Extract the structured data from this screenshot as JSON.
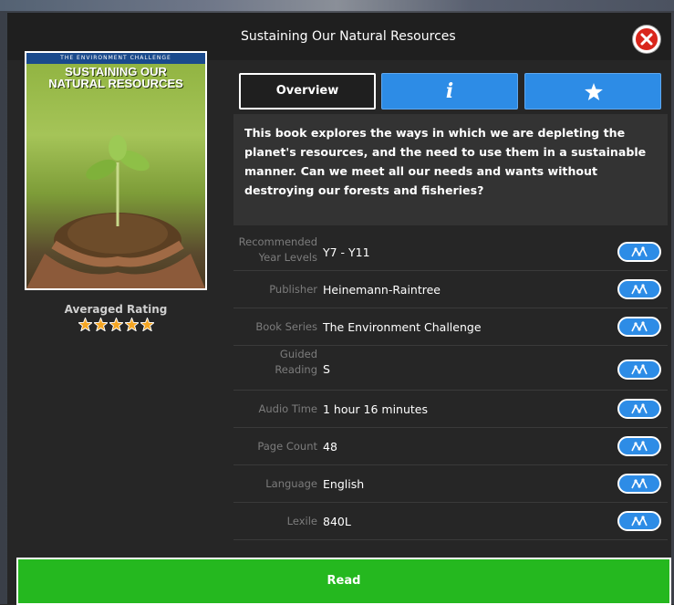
{
  "modal": {
    "title": "Sustaining Our Natural Resources"
  },
  "cover": {
    "series_banner": "THE ENVIRONMENT CHALLENGE",
    "title_line1": "SUSTAINING OUR",
    "title_line2": "NATURAL RESOURCES"
  },
  "rating": {
    "label": "Averaged Rating",
    "stars": 5,
    "max": 5,
    "color": "#f5a623"
  },
  "tabs": {
    "overview_label": "Overview",
    "info_glyph": "i"
  },
  "description": "This book explores the ways in which we are depleting the planet's resources, and the need to use them in a sustainable manner. Can we meet all our needs and wants without destroying our forests and fisheries?",
  "details": [
    {
      "label": "Recommended Year Levels",
      "value": "Y7 - Y11"
    },
    {
      "label": "Publisher",
      "value": "Heinemann-Raintree"
    },
    {
      "label": "Book Series",
      "value": "The Environment Challenge"
    },
    {
      "label": "Guided Reading",
      "value": "S"
    },
    {
      "label": "Audio Time",
      "value": "1 hour 16 minutes"
    },
    {
      "label": "Page Count",
      "value": "48"
    },
    {
      "label": "Language",
      "value": "English"
    },
    {
      "label": "Lexile",
      "value": "840L"
    }
  ],
  "read_button": {
    "label": "Read"
  },
  "colors": {
    "accent_blue": "#2d8ce6",
    "read_green": "#25b81f",
    "close_red": "#d9261c"
  }
}
